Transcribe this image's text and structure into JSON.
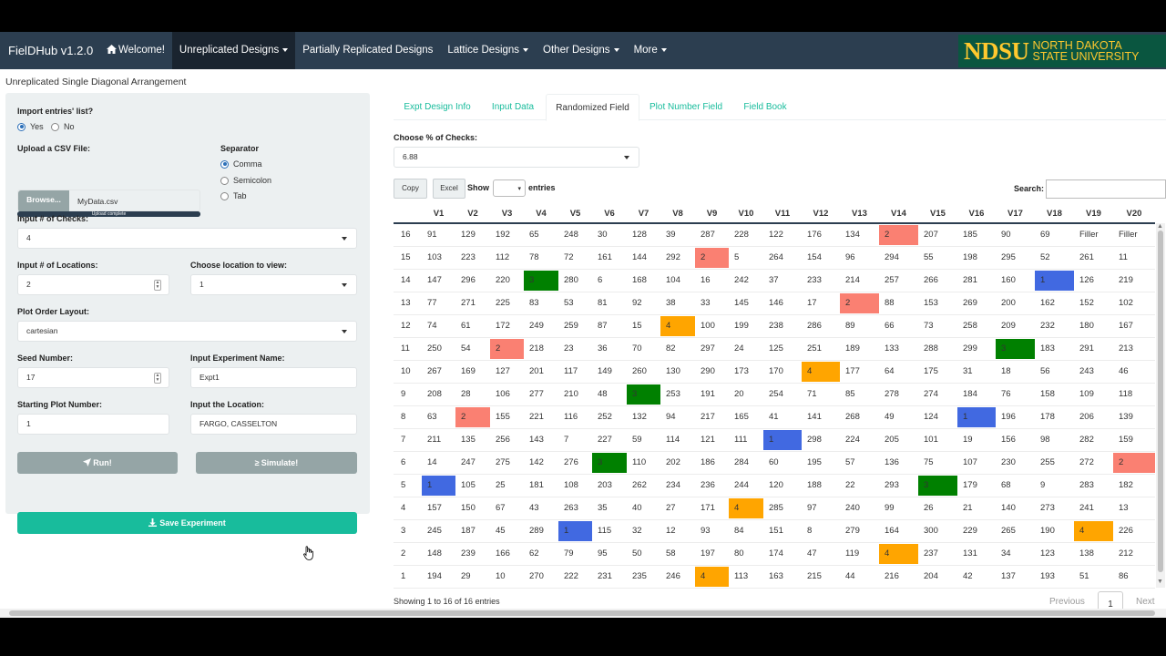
{
  "navbar": {
    "brand": "FielDHub v1.2.0",
    "items": [
      {
        "label": "Welcome!",
        "icon": "home-icon",
        "caret": false,
        "active": false
      },
      {
        "label": "Unreplicated Designs",
        "caret": true,
        "active": true
      },
      {
        "label": "Partially Replicated Designs",
        "caret": false,
        "active": false
      },
      {
        "label": "Lattice Designs",
        "caret": true,
        "active": false
      },
      {
        "label": "Other Designs",
        "caret": true,
        "active": false
      },
      {
        "label": "More",
        "caret": true,
        "active": false
      }
    ],
    "logo": {
      "big": "NDSU",
      "line1": "NORTH DAKOTA",
      "line2": "STATE UNIVERSITY"
    }
  },
  "page_title": "Unreplicated Single Diagonal Arrangement",
  "sidebar": {
    "import_label": "Import entries' list?",
    "import_options": [
      "Yes",
      "No"
    ],
    "import_selected": "Yes",
    "upload_label": "Upload a CSV File:",
    "browse_label": "Browse...",
    "file_name": "MyData.csv",
    "upload_status": "Upload complete",
    "upload_progress": 1.0,
    "separator_label": "Separator",
    "separator_options": [
      "Comma",
      "Semicolon",
      "Tab"
    ],
    "separator_selected": "Comma",
    "checks_label": "Input # of Checks:",
    "checks_value": "4",
    "locations_label": "Input # of Locations:",
    "locations_value": "2",
    "view_location_label": "Choose location to view:",
    "view_location_value": "1",
    "layout_label": "Plot Order Layout:",
    "layout_value": "cartesian",
    "seed_label": "Seed Number:",
    "seed_value": "17",
    "exp_name_label": "Input Experiment Name:",
    "exp_name_value": "Expt1",
    "start_plot_label": "Starting Plot Number:",
    "start_plot_value": "1",
    "location_label": "Input the Location:",
    "location_value": "FARGO, CASSELTON",
    "run_label": "Run!",
    "simulate_label": "Simulate!",
    "save_label": "Save Experiment"
  },
  "tabs": [
    {
      "label": "Expt Design Info",
      "active": false
    },
    {
      "label": "Input Data",
      "active": false
    },
    {
      "label": "Randomized Field",
      "active": true
    },
    {
      "label": "Plot Number Field",
      "active": false
    },
    {
      "label": "Field Book",
      "active": false
    }
  ],
  "checks_pct_label": "Choose % of Checks:",
  "checks_pct_value": "6.88",
  "buttons": {
    "copy": "Copy",
    "excel": "Excel"
  },
  "show_label": "Show",
  "entries_label": "entries",
  "search_label": "Search:",
  "check_colors": {
    "1": "#4169e1",
    "2": "#fa8072",
    "3": "#008000",
    "4": "#ffa500"
  },
  "table": {
    "columns": [
      "",
      "V1",
      "V2",
      "V3",
      "V4",
      "V5",
      "V6",
      "V7",
      "V8",
      "V9",
      "V10",
      "V11",
      "V12",
      "V13",
      "V14",
      "V15",
      "V16",
      "V17",
      "V18",
      "V19",
      "V20"
    ],
    "rows": [
      [
        "16",
        "91",
        "129",
        "192",
        "65",
        "248",
        "30",
        "128",
        "39",
        "287",
        "228",
        "122",
        "176",
        "134",
        "2",
        "207",
        "185",
        "90",
        "69",
        "Filler",
        "Filler"
      ],
      [
        "15",
        "103",
        "223",
        "112",
        "78",
        "72",
        "161",
        "144",
        "292",
        "2",
        "5",
        "264",
        "154",
        "96",
        "294",
        "55",
        "198",
        "295",
        "52",
        "261",
        "11"
      ],
      [
        "14",
        "147",
        "296",
        "220",
        "3",
        "280",
        "6",
        "168",
        "104",
        "16",
        "242",
        "37",
        "233",
        "214",
        "257",
        "266",
        "281",
        "160",
        "1",
        "126",
        "219"
      ],
      [
        "13",
        "77",
        "271",
        "225",
        "83",
        "53",
        "81",
        "92",
        "38",
        "33",
        "145",
        "146",
        "17",
        "2",
        "88",
        "153",
        "269",
        "200",
        "162",
        "152",
        "102"
      ],
      [
        "12",
        "74",
        "61",
        "172",
        "249",
        "259",
        "87",
        "15",
        "4",
        "100",
        "199",
        "238",
        "286",
        "89",
        "66",
        "73",
        "258",
        "209",
        "232",
        "180",
        "167"
      ],
      [
        "11",
        "250",
        "54",
        "2",
        "218",
        "23",
        "36",
        "70",
        "82",
        "297",
        "24",
        "125",
        "251",
        "189",
        "133",
        "288",
        "299",
        "3",
        "183",
        "291",
        "213"
      ],
      [
        "10",
        "267",
        "169",
        "127",
        "201",
        "117",
        "149",
        "260",
        "130",
        "290",
        "173",
        "170",
        "4",
        "177",
        "64",
        "175",
        "31",
        "18",
        "56",
        "243",
        "46"
      ],
      [
        "9",
        "208",
        "28",
        "106",
        "277",
        "210",
        "48",
        "3",
        "253",
        "191",
        "20",
        "254",
        "71",
        "85",
        "278",
        "274",
        "184",
        "76",
        "158",
        "109",
        "118"
      ],
      [
        "8",
        "63",
        "2",
        "155",
        "221",
        "116",
        "252",
        "132",
        "94",
        "217",
        "165",
        "41",
        "141",
        "268",
        "49",
        "124",
        "1",
        "196",
        "178",
        "206",
        "139"
      ],
      [
        "7",
        "211",
        "135",
        "256",
        "143",
        "7",
        "227",
        "59",
        "114",
        "121",
        "111",
        "1",
        "298",
        "224",
        "205",
        "101",
        "19",
        "156",
        "98",
        "282",
        "159"
      ],
      [
        "6",
        "14",
        "247",
        "275",
        "142",
        "276",
        "3",
        "110",
        "202",
        "186",
        "284",
        "60",
        "195",
        "57",
        "136",
        "75",
        "107",
        "230",
        "255",
        "272",
        "2"
      ],
      [
        "5",
        "1",
        "105",
        "25",
        "181",
        "108",
        "203",
        "262",
        "234",
        "236",
        "244",
        "120",
        "188",
        "22",
        "293",
        "3",
        "179",
        "68",
        "9",
        "283",
        "182"
      ],
      [
        "4",
        "157",
        "150",
        "67",
        "43",
        "263",
        "35",
        "40",
        "27",
        "171",
        "4",
        "285",
        "97",
        "240",
        "99",
        "26",
        "21",
        "140",
        "273",
        "241",
        "13"
      ],
      [
        "3",
        "245",
        "187",
        "45",
        "289",
        "1",
        "115",
        "32",
        "12",
        "93",
        "84",
        "151",
        "8",
        "279",
        "164",
        "300",
        "229",
        "265",
        "190",
        "4",
        "226"
      ],
      [
        "2",
        "148",
        "239",
        "166",
        "62",
        "79",
        "95",
        "50",
        "58",
        "197",
        "80",
        "174",
        "47",
        "119",
        "4",
        "237",
        "131",
        "34",
        "123",
        "138",
        "212"
      ],
      [
        "1",
        "194",
        "29",
        "10",
        "270",
        "222",
        "231",
        "235",
        "246",
        "4",
        "113",
        "163",
        "215",
        "44",
        "216",
        "204",
        "42",
        "137",
        "193",
        "51",
        "86"
      ]
    ],
    "check_cells": [
      [
        0,
        14,
        "2"
      ],
      [
        1,
        9,
        "2"
      ],
      [
        2,
        4,
        "3"
      ],
      [
        2,
        18,
        "1"
      ],
      [
        3,
        13,
        "2"
      ],
      [
        4,
        8,
        "4"
      ],
      [
        5,
        3,
        "2"
      ],
      [
        5,
        17,
        "3"
      ],
      [
        6,
        12,
        "4"
      ],
      [
        7,
        7,
        "3"
      ],
      [
        8,
        2,
        "2"
      ],
      [
        8,
        16,
        "1"
      ],
      [
        9,
        11,
        "1"
      ],
      [
        10,
        6,
        "3"
      ],
      [
        10,
        20,
        "2"
      ],
      [
        11,
        1,
        "1"
      ],
      [
        11,
        15,
        "3"
      ],
      [
        12,
        10,
        "4"
      ],
      [
        13,
        5,
        "1"
      ],
      [
        13,
        19,
        "4"
      ],
      [
        14,
        14,
        "4"
      ],
      [
        15,
        9,
        "4"
      ]
    ]
  },
  "info": "Showing 1 to 16 of 16 entries",
  "pagination": {
    "previous": "Previous",
    "current": "1",
    "next": "Next"
  }
}
